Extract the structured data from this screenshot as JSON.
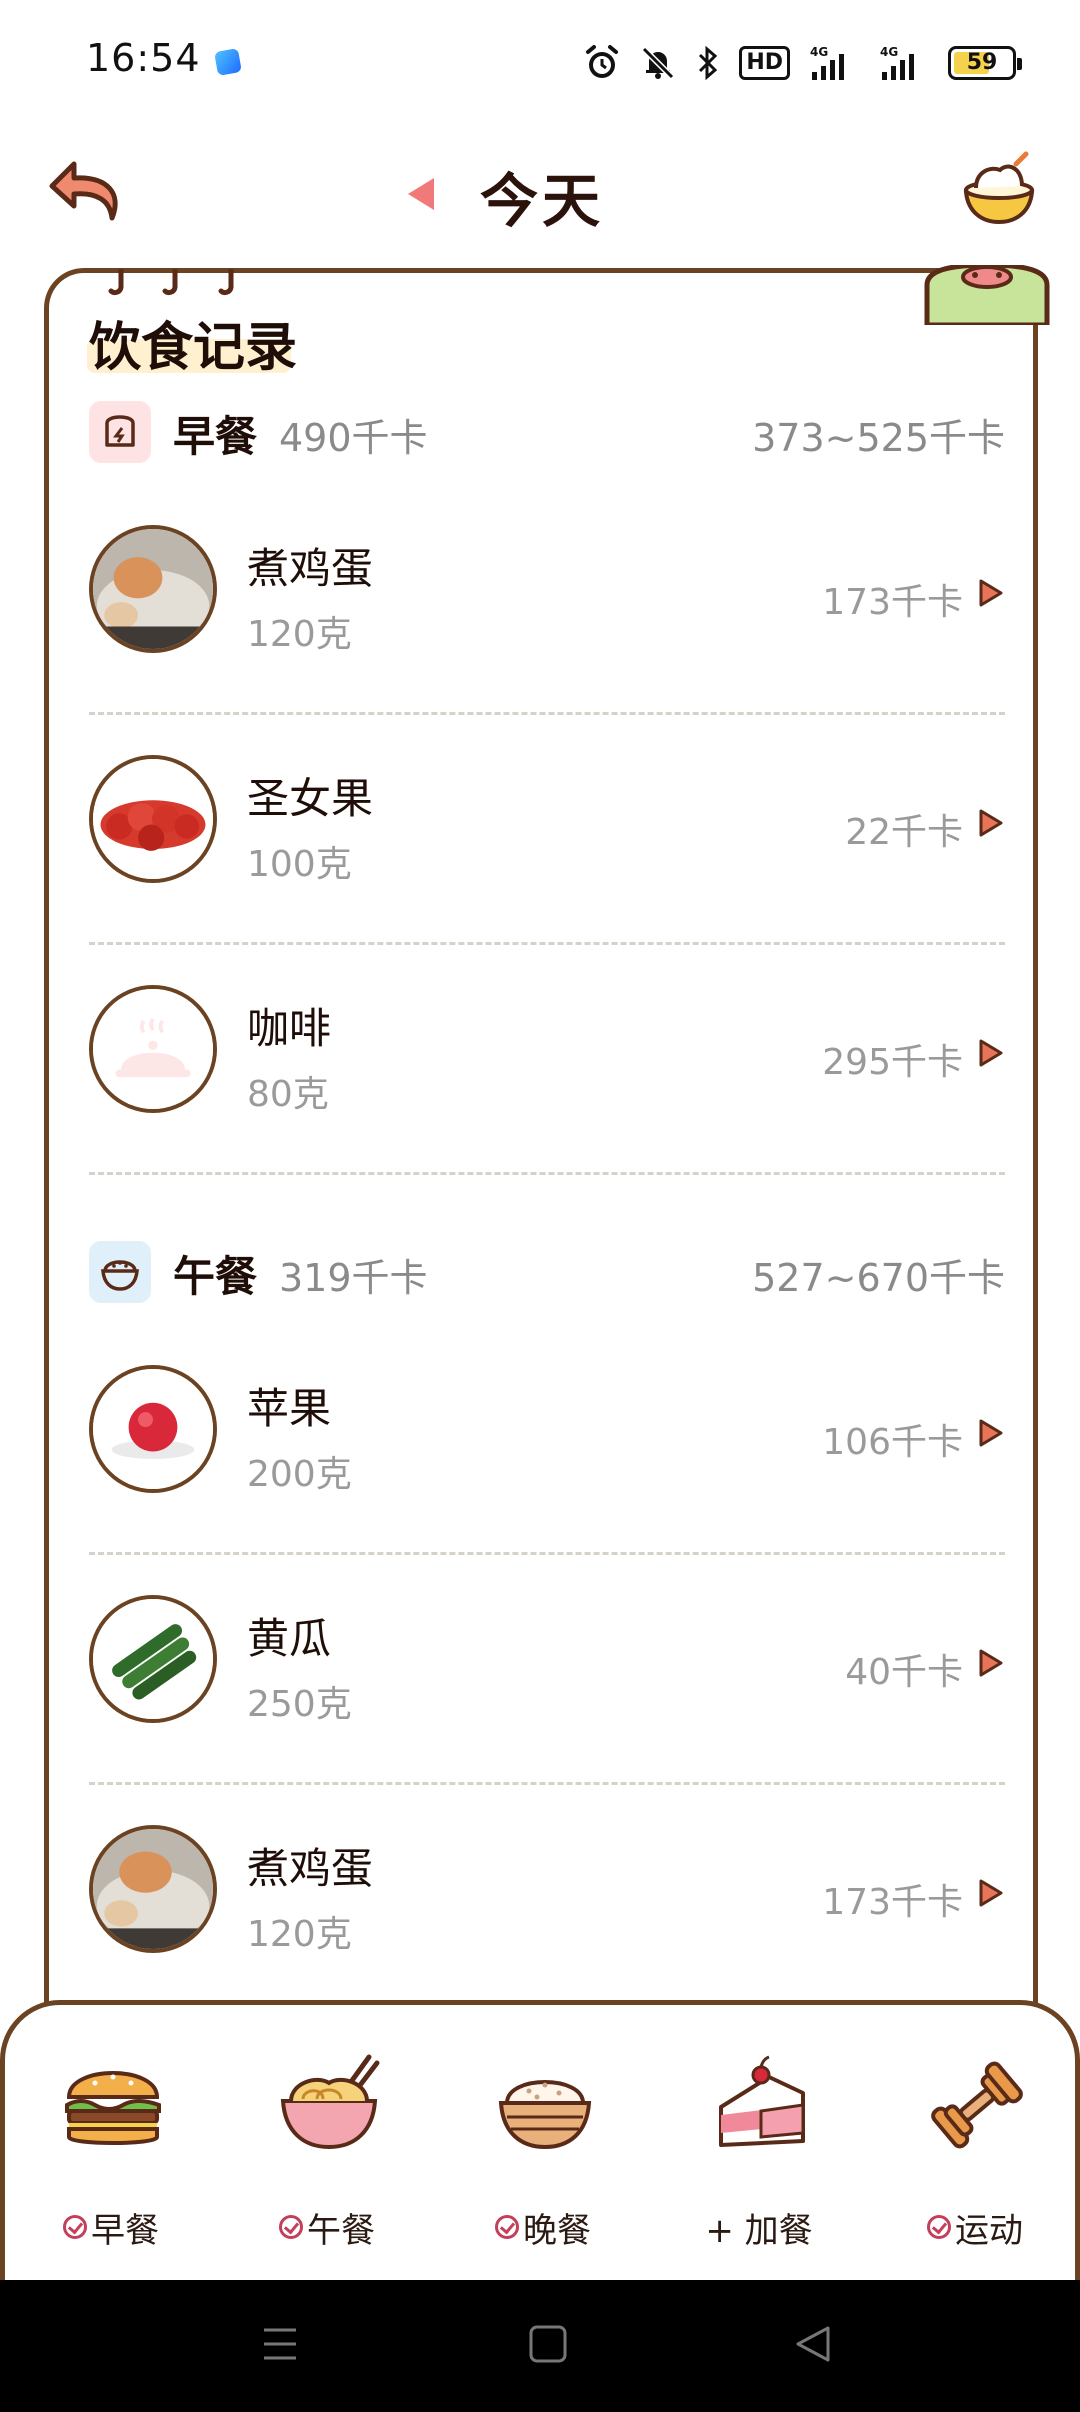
{
  "status_bar": {
    "time": "16:54",
    "hd_label": "HD",
    "net1": "4G",
    "net2": "4G",
    "battery": "59"
  },
  "header": {
    "title": "今天"
  },
  "card": {
    "title": "饮食记录"
  },
  "meals": [
    {
      "name": "早餐",
      "kcal": "490千卡",
      "range": "373~525千卡",
      "icon_color": "#fde3e3",
      "foods": [
        {
          "name": "煮鸡蛋",
          "weight": "120克",
          "kcal": "173千卡",
          "image": "boiled-egg"
        },
        {
          "name": "圣女果",
          "weight": "100克",
          "kcal": "22千卡",
          "image": "cherry-tomatoes"
        },
        {
          "name": "咖啡",
          "weight": "80克",
          "kcal": "295千卡",
          "image": "placeholder-dish"
        }
      ]
    },
    {
      "name": "午餐",
      "kcal": "319千卡",
      "range": "527~670千卡",
      "icon_color": "#e0f0fb",
      "foods": [
        {
          "name": "苹果",
          "weight": "200克",
          "kcal": "106千卡",
          "image": "apple"
        },
        {
          "name": "黄瓜",
          "weight": "250克",
          "kcal": "40千卡",
          "image": "cucumber"
        },
        {
          "name": "煮鸡蛋",
          "weight": "120克",
          "kcal": "173千卡",
          "image": "boiled-egg"
        }
      ]
    }
  ],
  "add_bar": [
    {
      "label": "早餐",
      "checked": true,
      "icon": "burger-icon"
    },
    {
      "label": "午餐",
      "checked": true,
      "icon": "noodle-bowl-icon"
    },
    {
      "label": "晚餐",
      "checked": true,
      "icon": "rice-bowl-icon"
    },
    {
      "label": "+ 加餐",
      "checked": false,
      "icon": "cake-icon"
    },
    {
      "label": "运动",
      "checked": true,
      "icon": "dumbbell-icon"
    }
  ],
  "colors": {
    "brown_border": "#6b4322",
    "accent_arrow": "#e8745a",
    "muted_text": "#9a9a9a"
  }
}
